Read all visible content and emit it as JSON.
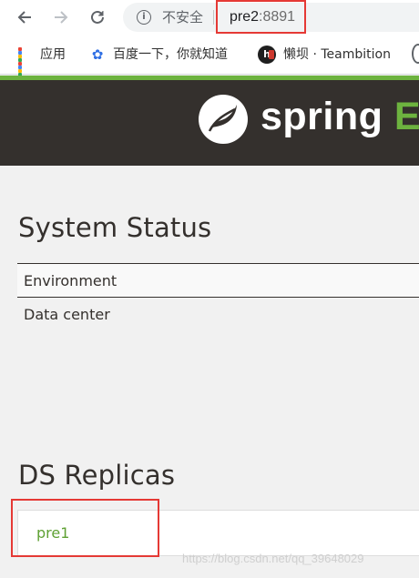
{
  "browser": {
    "nav": {
      "back_icon": "arrow-left-icon",
      "forward_icon": "arrow-right-icon",
      "reload_icon": "reload-icon"
    },
    "omnibox": {
      "security_label": "不安全",
      "host": "pre2",
      "port": ":8891"
    },
    "bookmarks": [
      {
        "label": "应用",
        "icon": "apps-grid-icon"
      },
      {
        "label": "百度一下，你就知道",
        "icon": "baidu-paw-icon"
      },
      {
        "label": "懒坝 · Teambition",
        "icon": "teambition-icon"
      }
    ],
    "highlight_color": "#e53935"
  },
  "header": {
    "logo_text": "spring",
    "logo_suffix": "E",
    "accent_color": "#6db33f",
    "background_color": "#34302d"
  },
  "system_status": {
    "title": "System Status",
    "rows": [
      {
        "label": "Environment"
      },
      {
        "label": "Data center"
      }
    ]
  },
  "ds_replicas": {
    "title": "DS Replicas",
    "items": [
      {
        "label": "pre1"
      }
    ]
  },
  "watermark": "https://blog.csdn.net/qq_39648029"
}
